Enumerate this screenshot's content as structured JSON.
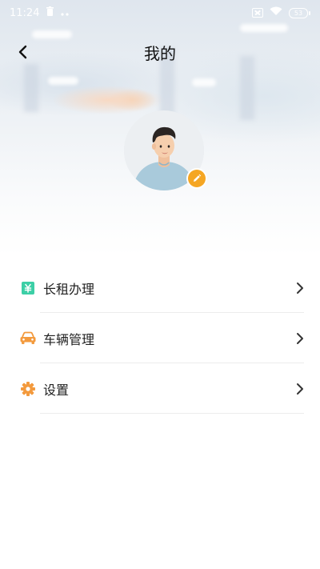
{
  "status_bar": {
    "time": "11:24",
    "battery": "53"
  },
  "header": {
    "title": "我的"
  },
  "menu": {
    "items": [
      {
        "id": "long-rent",
        "label": "长租办理",
        "icon": "yuan-ticket-icon",
        "color": "#3ccfa6"
      },
      {
        "id": "vehicle",
        "label": "车辆管理",
        "icon": "car-icon",
        "color": "#f39a3d"
      },
      {
        "id": "settings",
        "label": "设置",
        "icon": "gear-icon",
        "color": "#f39a3d"
      }
    ]
  },
  "colors": {
    "edit_badge": "#f5a623",
    "avatar_shirt": "#a9cadb"
  }
}
